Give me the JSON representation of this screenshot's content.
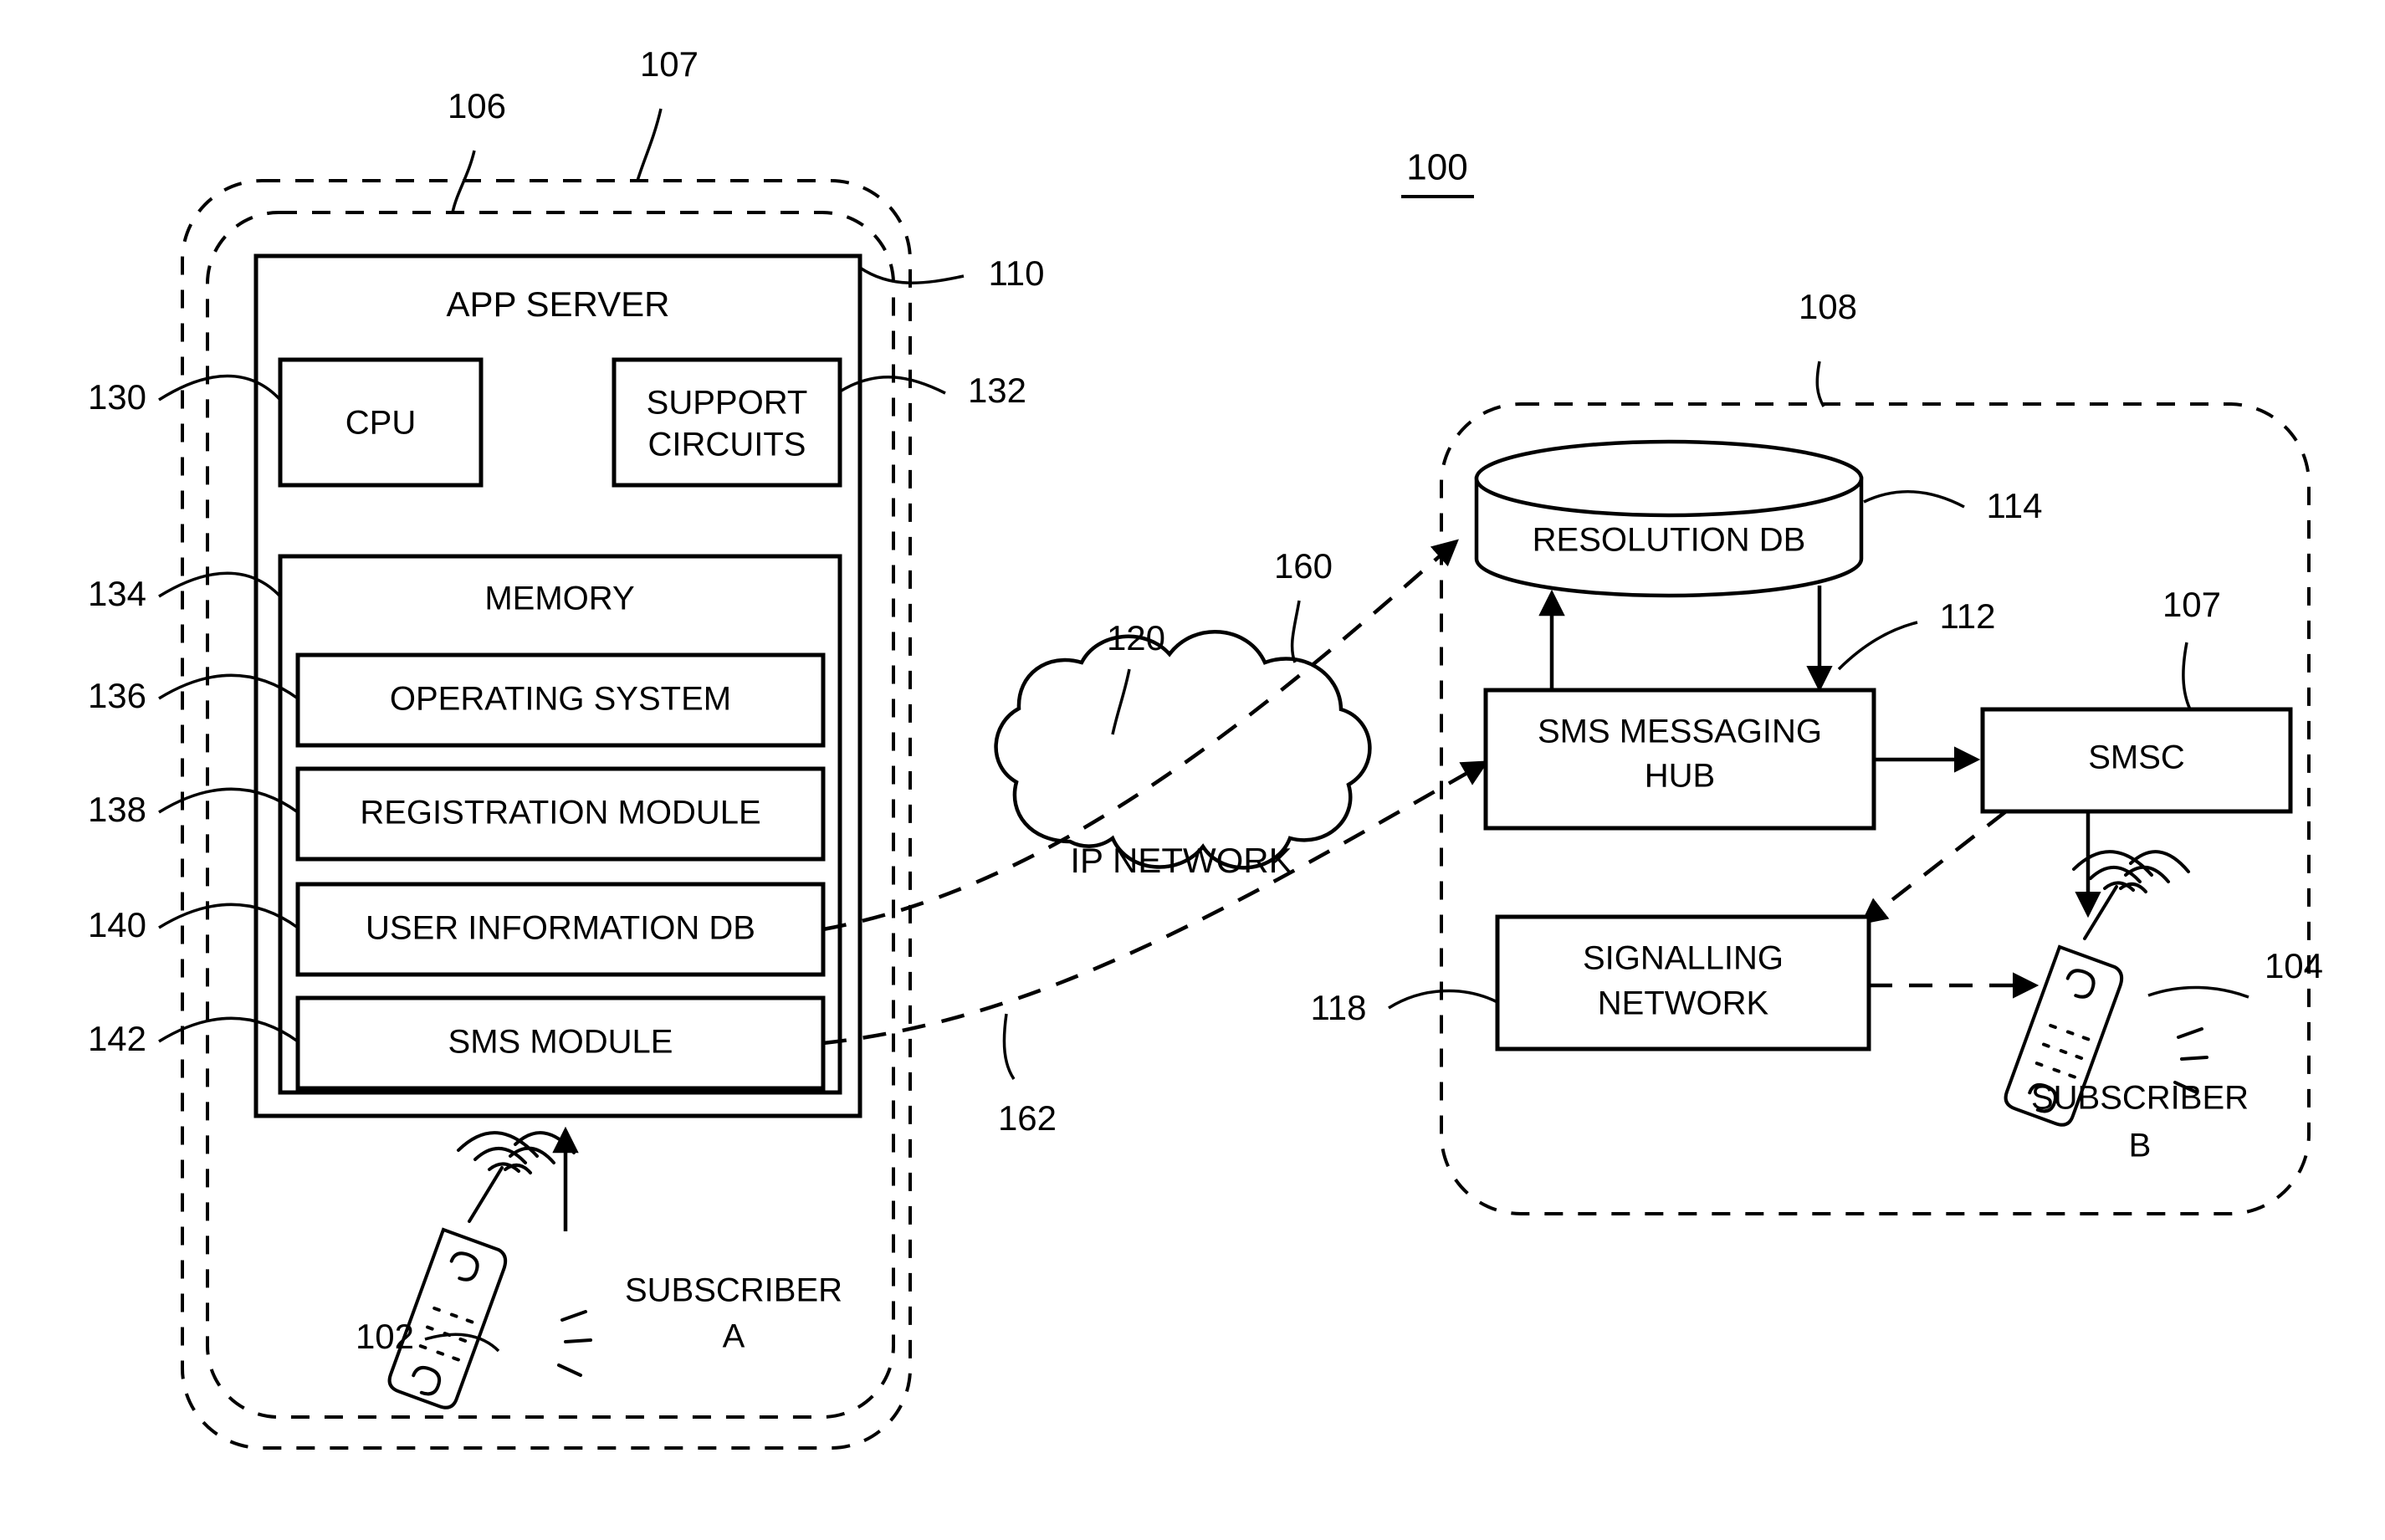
{
  "figure": {
    "id": "100",
    "type": "patent-block-diagram"
  },
  "left_system": {
    "outer_boundary_ref": "106",
    "inner_boundary_ref": "107",
    "app_server": {
      "title": "APP SERVER",
      "ref": "110",
      "cpu": {
        "label": "CPU",
        "ref": "130"
      },
      "support_circuits": {
        "label": "SUPPORT CIRCUITS",
        "line1": "SUPPORT",
        "line2": "CIRCUITS",
        "ref": "132"
      },
      "memory": {
        "label": "MEMORY",
        "ref": "134",
        "modules": [
          {
            "label": "OPERATING SYSTEM",
            "ref": "136"
          },
          {
            "label": "REGISTRATION MODULE",
            "ref": "138"
          },
          {
            "label": "USER INFORMATION DB",
            "ref": "140"
          },
          {
            "label": "SMS MODULE",
            "ref": "142"
          }
        ]
      }
    },
    "subscriber": {
      "line1": "SUBSCRIBER",
      "line2": "A",
      "device_ref": "102",
      "device_icon": "mobile-phone-icon"
    }
  },
  "network": {
    "cloud": {
      "label": "IP NETWORK",
      "ref": "120"
    },
    "flows": [
      {
        "ref": "160",
        "name": "registration-flow"
      },
      {
        "ref": "162",
        "name": "sms-flow"
      }
    ]
  },
  "right_system": {
    "boundary_ref": "108",
    "resolution_db": {
      "label": "RESOLUTION DB",
      "ref": "114",
      "shape": "cylinder-database"
    },
    "sms_hub": {
      "label": "SMS MESSAGING HUB",
      "line1": "SMS MESSAGING",
      "line2": "HUB",
      "ref": "112"
    },
    "smsc": {
      "label": "SMSC",
      "ref": "107"
    },
    "signalling_network": {
      "label": "SIGNALLING NETWORK",
      "line1": "SIGNALLING",
      "line2": "NETWORK",
      "ref": "118"
    },
    "subscriber": {
      "line1": "SUBSCRIBER",
      "line2": "B",
      "device_ref": "104",
      "device_icon": "mobile-phone-icon"
    }
  },
  "colors": {
    "ink": "#000000",
    "paper": "#ffffff"
  }
}
